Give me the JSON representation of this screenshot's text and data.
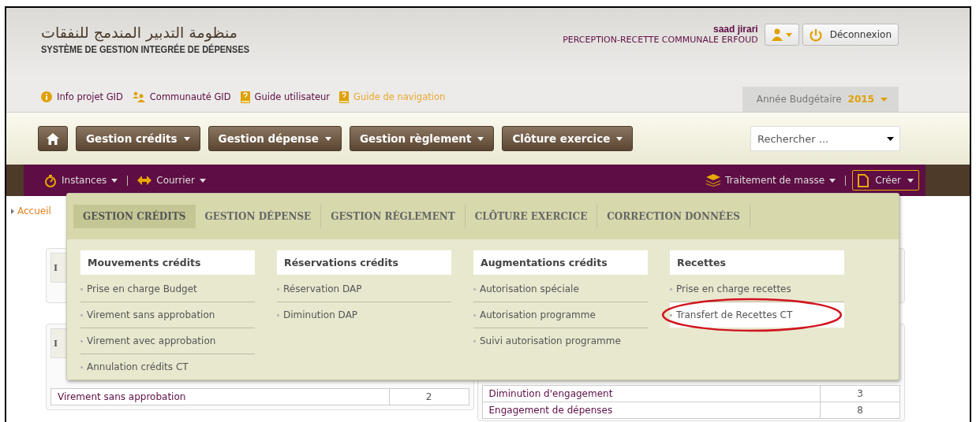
{
  "header": {
    "arabic_title": "منظومة التدبير المندمج للنفقات",
    "title": "SYSTÈME DE GESTION INTEGRÉE DE DÉPENSES",
    "user_name": "saad jirari",
    "organisation": "PERCEPTION-RECETTE COMMUNALE ERFOUD",
    "logout": "Déconnexion"
  },
  "links": [
    {
      "label": "Info projet GID",
      "kind": "info",
      "highlighted": false
    },
    {
      "label": "Communauté GID",
      "kind": "community",
      "highlighted": false
    },
    {
      "label": "Guide utilisateur",
      "kind": "guide",
      "highlighted": false
    },
    {
      "label": "Guide de navigation",
      "kind": "guide",
      "highlighted": true
    }
  ],
  "year_selector": {
    "label": "Année Budgétaire",
    "value": "2015"
  },
  "nav": {
    "menus": [
      "Gestion crédits",
      "Gestion dépense",
      "Gestion règlement",
      "Clôture exercice"
    ],
    "search": {
      "placeholder": "Rechercher ..."
    }
  },
  "toolbar": {
    "left": [
      {
        "label": "Instances",
        "kind": "timer"
      },
      {
        "label": "Courrier",
        "kind": "arrows"
      }
    ],
    "right": [
      {
        "label": "Traitement de masse",
        "kind": "layers"
      },
      {
        "label": "Créer",
        "kind": "document"
      }
    ]
  },
  "breadcrumb": "Accueil",
  "mega_menu": {
    "tabs": [
      {
        "label": "GESTION CRÉDITS",
        "selected": true
      },
      {
        "label": "GESTION DÉPENSE",
        "selected": false
      },
      {
        "label": "GESTION RÈGLEMENT",
        "selected": false
      },
      {
        "label": "CLÔTURE EXERCICE",
        "selected": false
      },
      {
        "label": "CORRECTION DONNÉES",
        "selected": false
      }
    ],
    "columns": [
      {
        "heading": "Mouvements crédits",
        "items": [
          {
            "label": "Prise en charge Budget",
            "hovered": false,
            "circled": false
          },
          {
            "label": "Virement sans approbation",
            "hovered": false,
            "circled": false
          },
          {
            "label": "Virement avec approbation",
            "hovered": false,
            "circled": false
          },
          {
            "label": "Annulation crédits CT",
            "hovered": false,
            "circled": false
          }
        ]
      },
      {
        "heading": "Réservations crédits",
        "items": [
          {
            "label": "Réservation DAP",
            "hovered": false,
            "circled": false
          },
          {
            "label": "Diminution DAP",
            "hovered": false,
            "circled": false
          }
        ]
      },
      {
        "heading": "Augmentations crédits",
        "items": [
          {
            "label": "Autorisation spéciale",
            "hovered": false,
            "circled": false
          },
          {
            "label": "Autorisation programme",
            "hovered": false,
            "circled": false
          },
          {
            "label": "Suivi autorisation programme",
            "hovered": false,
            "circled": false
          }
        ]
      },
      {
        "heading": "Recettes",
        "items": [
          {
            "label": "Prise en charge recettes",
            "hovered": false,
            "circled": false
          },
          {
            "label": "Transfert de Recettes CT",
            "hovered": true,
            "circled": true
          }
        ]
      }
    ]
  },
  "panels": {
    "left": [
      {
        "heading": "I"
      },
      {
        "heading": "I",
        "rows": [
          {
            "label": "Virement sans approbation",
            "count": "2"
          }
        ]
      }
    ],
    "right": [
      {
        "kind": "empty"
      },
      {
        "rows": [
          {
            "label": "Diminution d'engagement",
            "count": "3"
          },
          {
            "label": "Engagement de dépenses",
            "count": "8"
          }
        ]
      }
    ]
  }
}
